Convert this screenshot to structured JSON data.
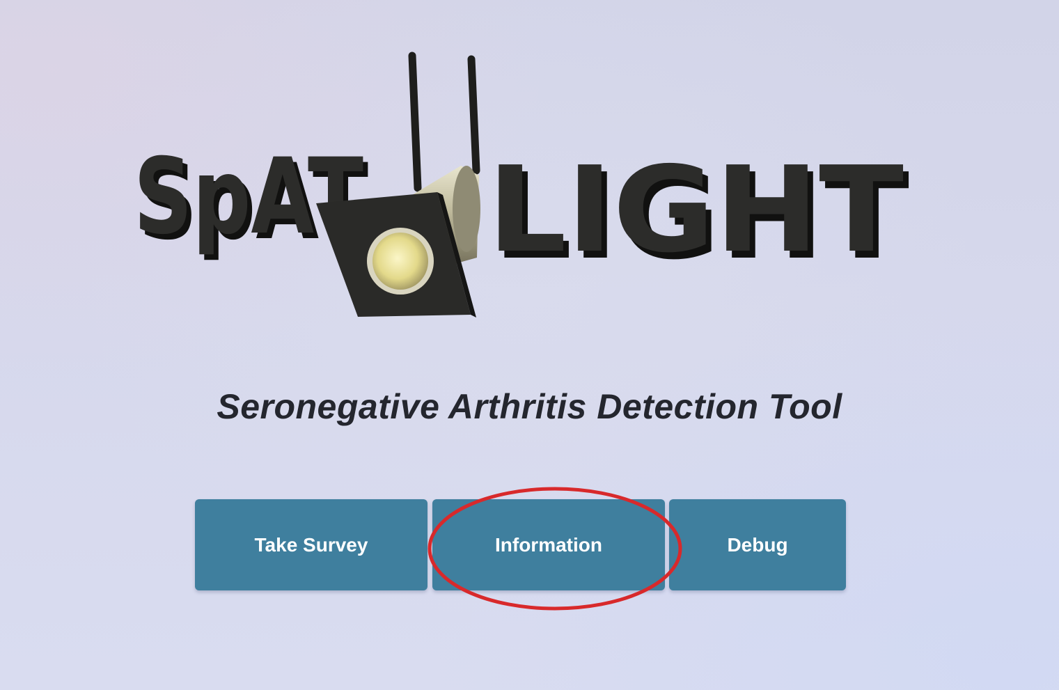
{
  "logo": {
    "part1": "SpAT",
    "part2": "LIGHT"
  },
  "subtitle": "Seronegative Arthritis Detection Tool",
  "buttons": {
    "survey": "Take Survey",
    "information": "Information",
    "debug": "Debug"
  },
  "colors": {
    "button": "#3f7f9e",
    "annotation": "#d8292b"
  }
}
